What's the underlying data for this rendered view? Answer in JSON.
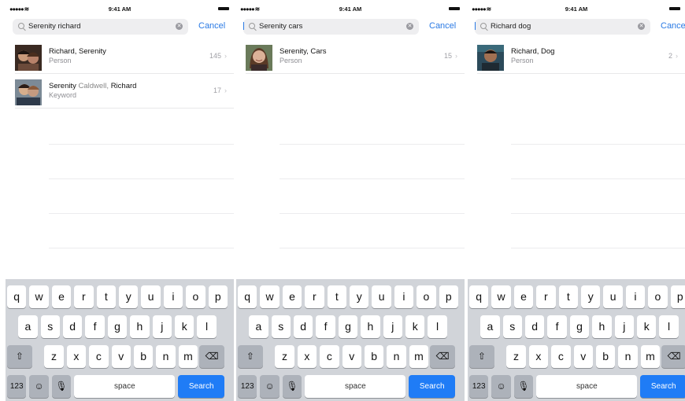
{
  "status_bar": {
    "signal": "●●●●● ≋",
    "time": "9:41 AM"
  },
  "screens": [
    {
      "search": {
        "query": "Serenity richard",
        "cancel_label": "Cancel"
      },
      "results": [
        {
          "title": "Richard, Serenity",
          "subtitle": "Person",
          "count": "145",
          "thumb": "photo-couple-selfie"
        },
        {
          "title_parts": [
            "Serenity",
            " Caldwell, ",
            "Richard"
          ],
          "subtitle": "Keyword",
          "count": "17",
          "thumb": "photo-couple-hug"
        }
      ]
    },
    {
      "search": {
        "query": "Serenity cars",
        "cancel_label": "Cancel"
      },
      "results": [
        {
          "title": "Serenity, Cars",
          "subtitle": "Person",
          "count": "15",
          "thumb": "photo-woman-smiling"
        }
      ]
    },
    {
      "search": {
        "query": "Richard dog",
        "cancel_label": "Cancel"
      },
      "results": [
        {
          "title": "Richard, Dog",
          "subtitle": "Person",
          "count": "2",
          "thumb": "photo-man-portrait"
        }
      ]
    }
  ],
  "keyboard": {
    "row1": [
      "q",
      "w",
      "e",
      "r",
      "t",
      "y",
      "u",
      "i",
      "o",
      "p"
    ],
    "row2": [
      "a",
      "s",
      "d",
      "f",
      "g",
      "h",
      "j",
      "k",
      "l"
    ],
    "row3": [
      "z",
      "x",
      "c",
      "v",
      "b",
      "n",
      "m"
    ],
    "shift_icon": "shift-icon",
    "delete_icon": "backspace-icon",
    "numbers_label": "123",
    "emoji_icon": "emoji-icon",
    "mic_icon": "microphone-icon",
    "space_label": "space",
    "search_label": "Search"
  },
  "colors": {
    "accent": "#2a7ae4",
    "search_key": "#1f7cf6",
    "keyboard_bg": "#d1d4d9",
    "dark_key": "#adb2ba"
  },
  "chevron": "›"
}
